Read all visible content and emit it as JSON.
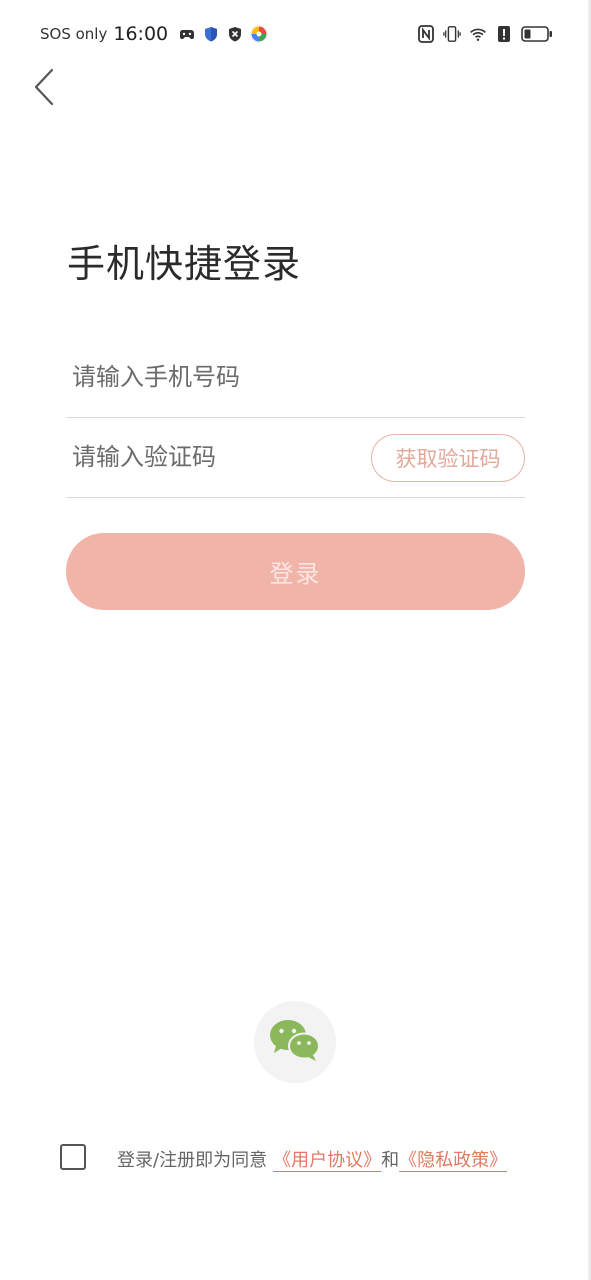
{
  "status_bar": {
    "carrier": "SOS only",
    "time": "16:00",
    "left_icons": [
      "cloud-game-icon",
      "shield-blue-icon",
      "shield-x-icon",
      "pinwheel-app-icon"
    ],
    "right_icons": [
      "nfc-icon",
      "vibrate-icon",
      "wifi-icon",
      "alert-icon",
      "battery-icon"
    ]
  },
  "header": {
    "back_icon": "chevron-left-icon"
  },
  "main": {
    "title": "手机快捷登录",
    "phone_input": {
      "placeholder": "请输入手机号码",
      "value": ""
    },
    "code_input": {
      "placeholder": "请输入验证码",
      "value": ""
    },
    "get_code_label": "获取验证码",
    "login_label": "登录"
  },
  "social": {
    "wechat_icon": "wechat-icon"
  },
  "agreement": {
    "checked": false,
    "prefix": "登录/注册即为同意",
    "user_agreement_link": "《用户协议》",
    "joiner": "和",
    "privacy_policy_link": "《隐私政策》"
  },
  "colors": {
    "accent": "#e07a63",
    "login_button_bg": "#f1b4a8",
    "get_code_border": "#e8b3a7",
    "wechat_green": "#8cb85c"
  }
}
